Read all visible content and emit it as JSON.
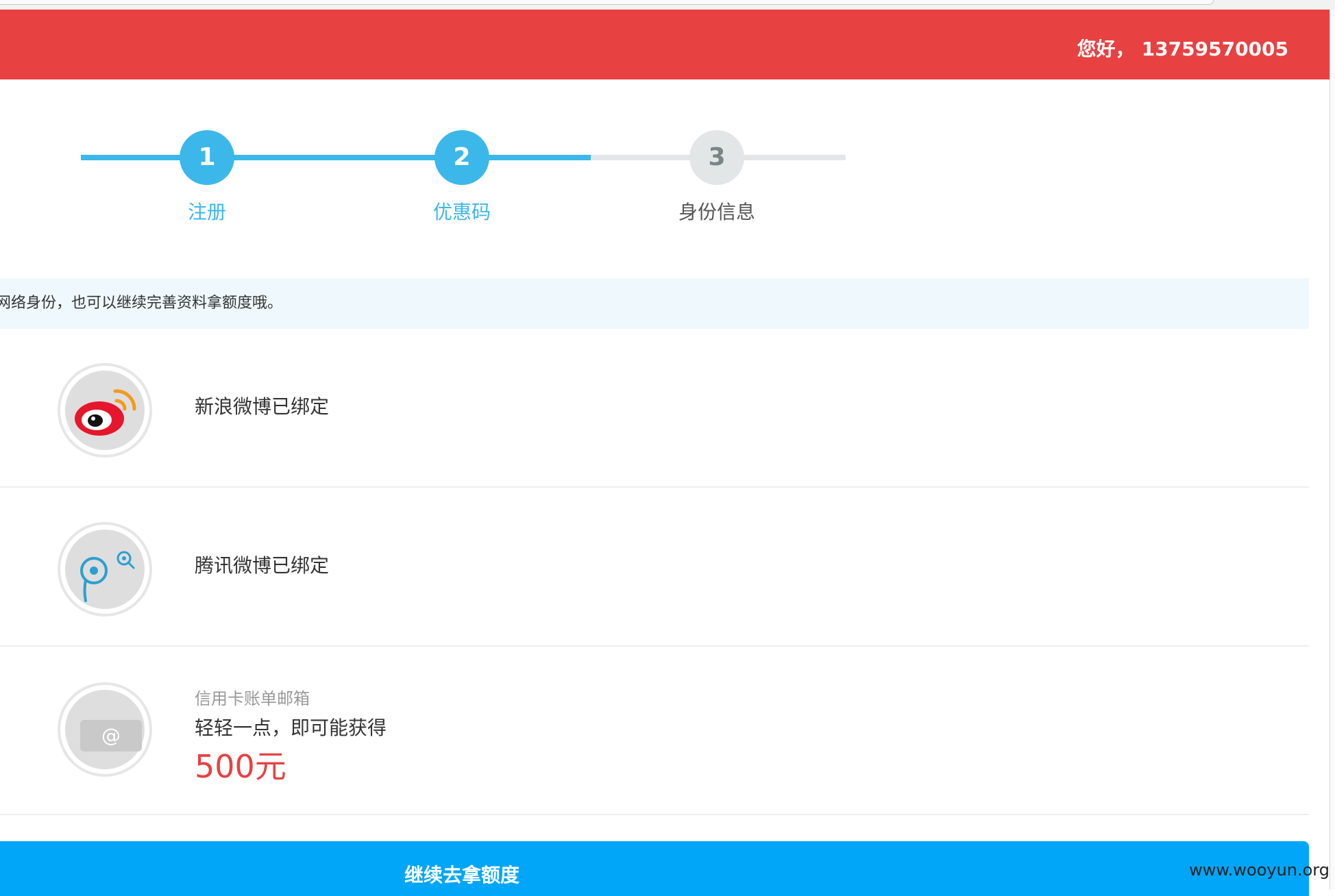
{
  "header": {
    "greeting": "您好，",
    "phone": "13759570005",
    "bg_color": "#e84142"
  },
  "stepper": {
    "steps": [
      {
        "number": "1",
        "label": "注册",
        "state": "done"
      },
      {
        "number": "2",
        "label": "优惠码",
        "state": "done"
      },
      {
        "number": "3",
        "label": "身份信息",
        "state": "pending"
      }
    ],
    "active_color": "#3cb7ea",
    "inactive_color": "#e3e6e6"
  },
  "info_bar": {
    "text": "网络身份，也可以继续完善资料拿额度哦。"
  },
  "bindings": [
    {
      "icon": "sina-weibo-icon",
      "text": "新浪微博已绑定"
    },
    {
      "icon": "tencent-weibo-icon",
      "text": "腾讯微博已绑定"
    }
  ],
  "email_offer": {
    "icon": "email-at-icon",
    "icon_text": "@",
    "title": "信用卡账单邮箱",
    "promo": "轻轻一点，即可能获得",
    "amount": "500元",
    "amount_color": "#e84142"
  },
  "cta": {
    "label": "继续去拿额度",
    "color": "#02a6f8"
  },
  "watermark": "www.wooyun.org"
}
